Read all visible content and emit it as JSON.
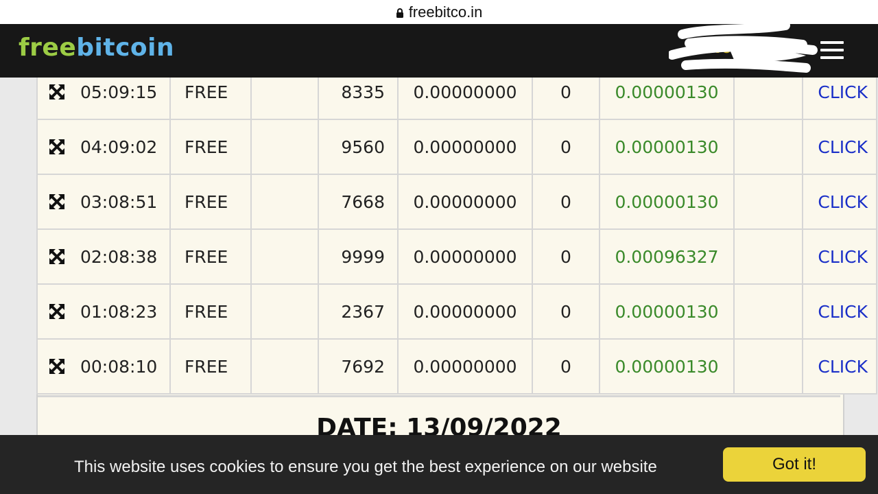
{
  "browser": {
    "url": "freebitco.in"
  },
  "header": {
    "logo_part1": "free",
    "logo_part2": "bitcoin",
    "balance": "฿ 0.0001",
    "menu_icon": "hamburger-icon"
  },
  "table": {
    "rows": [
      {
        "time": "05:09:15",
        "type": "FREE",
        "roll": "8335",
        "bet": "0.00000000",
        "count": "0",
        "win": "0.00000130",
        "action": "CLICK"
      },
      {
        "time": "04:09:02",
        "type": "FREE",
        "roll": "9560",
        "bet": "0.00000000",
        "count": "0",
        "win": "0.00000130",
        "action": "CLICK"
      },
      {
        "time": "03:08:51",
        "type": "FREE",
        "roll": "7668",
        "bet": "0.00000000",
        "count": "0",
        "win": "0.00000130",
        "action": "CLICK"
      },
      {
        "time": "02:08:38",
        "type": "FREE",
        "roll": "9999",
        "bet": "0.00000000",
        "count": "0",
        "win": "0.00096327",
        "action": "CLICK"
      },
      {
        "time": "01:08:23",
        "type": "FREE",
        "roll": "2367",
        "bet": "0.00000000",
        "count": "0",
        "win": "0.00000130",
        "action": "CLICK"
      },
      {
        "time": "00:08:10",
        "type": "FREE",
        "roll": "7692",
        "bet": "0.00000000",
        "count": "0",
        "win": "0.00000130",
        "action": "CLICK"
      }
    ],
    "row_icon": "expand-arrows-icon",
    "date_heading": "DATE: 13/09/2022"
  },
  "cookie_bar": {
    "message": "This website uses cookies to ensure you get the best experience on our website",
    "button_label": "Got it!"
  },
  "colors": {
    "header_bg": "#171717",
    "logo_free": "#9ccc45",
    "logo_bitcoin": "#5fb3e8",
    "win_green": "#3a8a2a",
    "click_blue": "#1a2fc8",
    "cookie_button": "#ebd33a"
  }
}
